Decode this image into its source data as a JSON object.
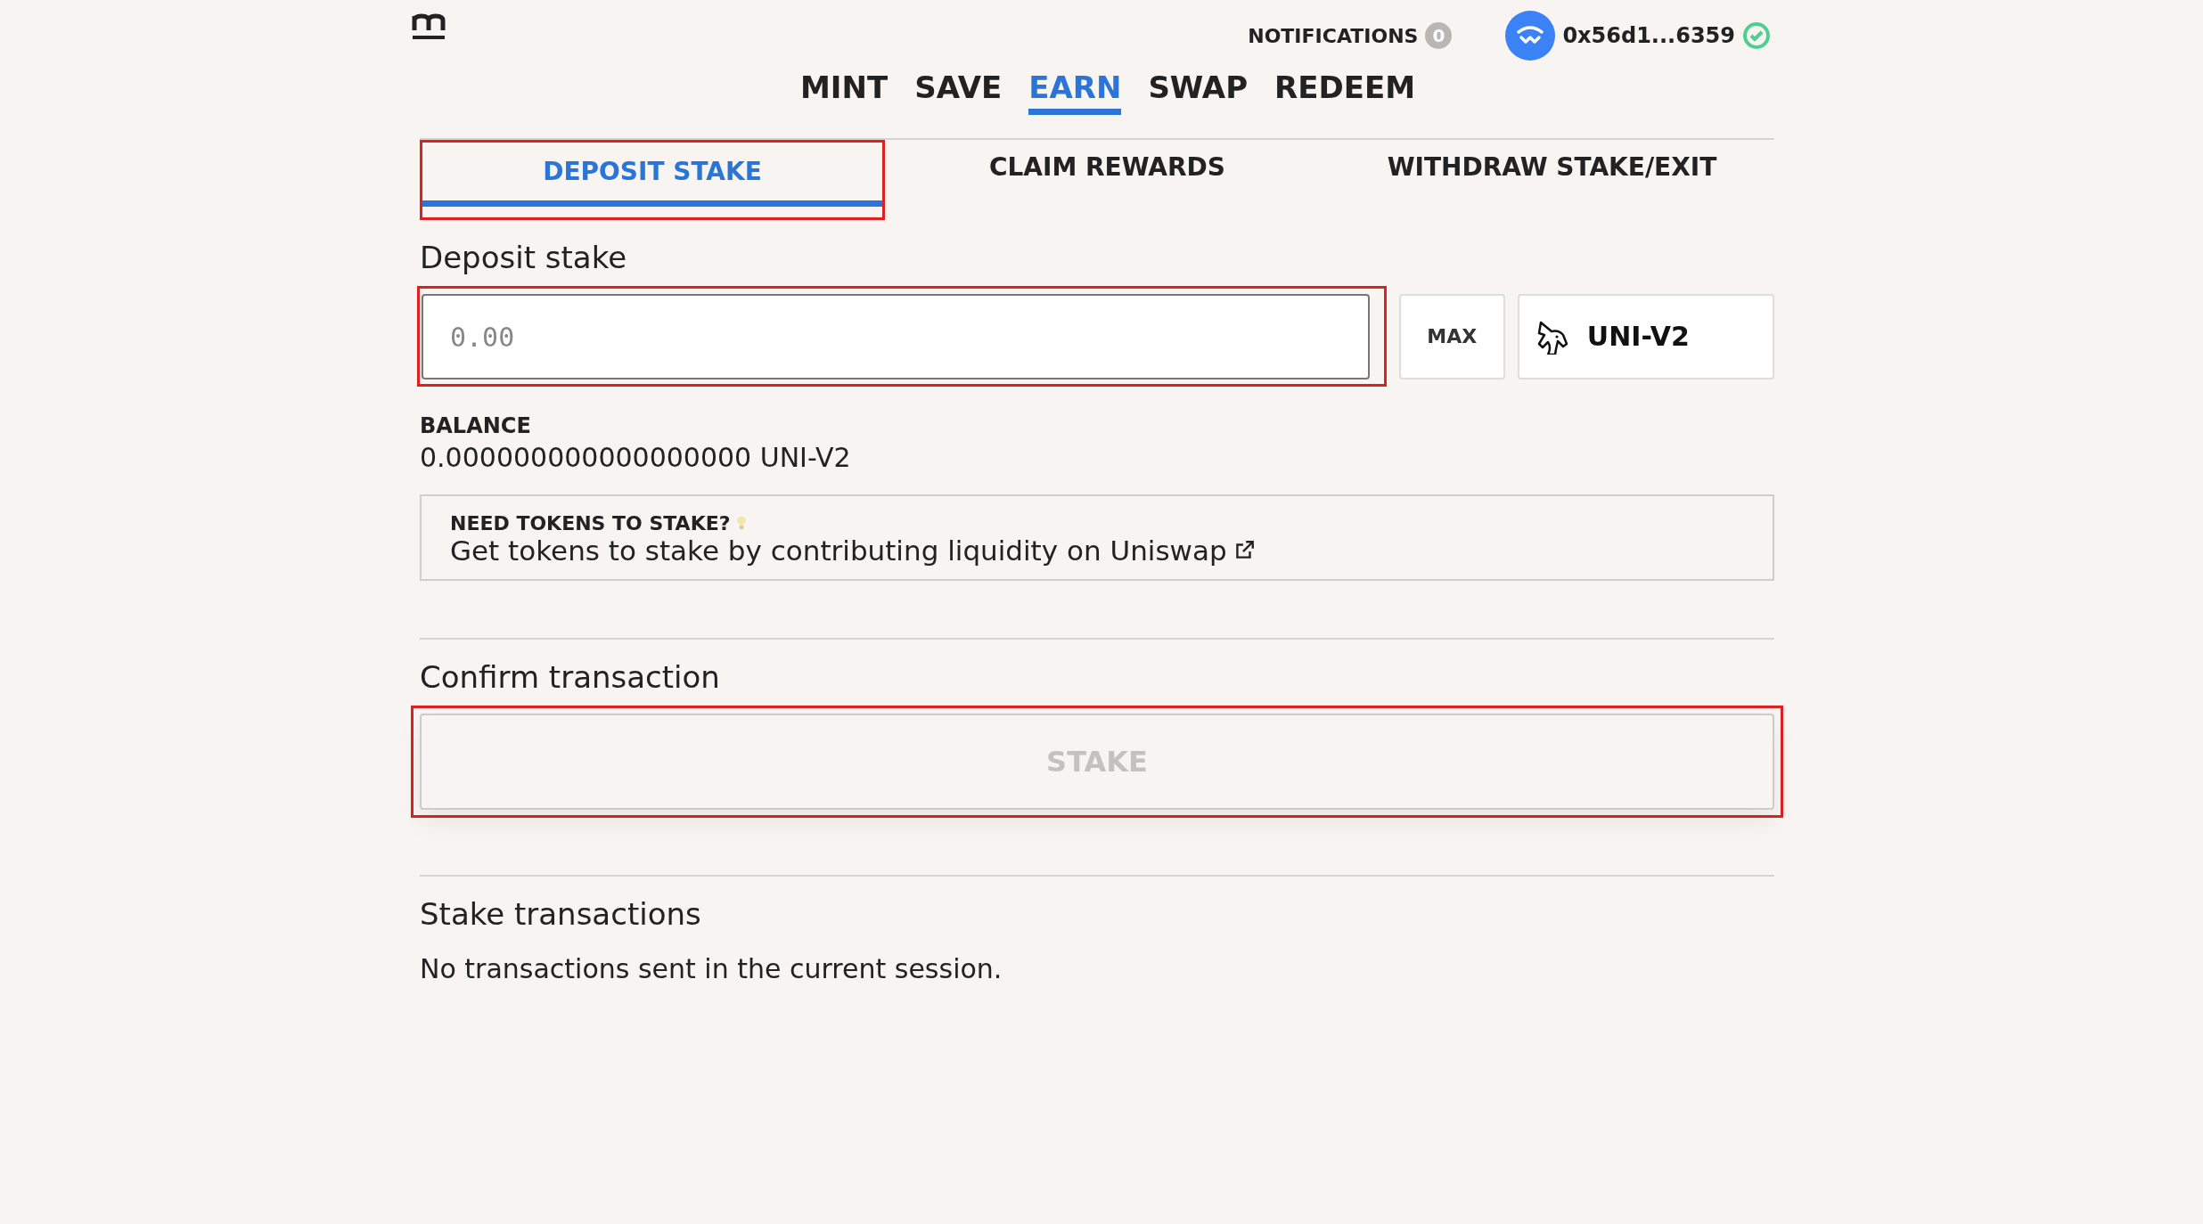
{
  "header": {
    "notifications": {
      "label": "NOTIFICATIONS",
      "count": "0"
    },
    "account": {
      "address": "0x56d1...6359",
      "verified": true
    }
  },
  "nav": [
    {
      "label": "MINT",
      "selected": false
    },
    {
      "label": "SAVE",
      "selected": false
    },
    {
      "label": "EARN",
      "selected": true
    },
    {
      "label": "SWAP",
      "selected": false
    },
    {
      "label": "REDEEM",
      "selected": false
    }
  ],
  "tabs": [
    {
      "label": "DEPOSIT STAKE",
      "selected": true,
      "highlighted": true
    },
    {
      "label": "CLAIM REWARDS",
      "selected": false,
      "highlighted": false
    },
    {
      "label": "WITHDRAW STAKE/EXIT",
      "selected": false,
      "highlighted": false
    }
  ],
  "deposit": {
    "heading": "Deposit stake",
    "amount_field": {
      "placeholder": "0.00",
      "highlighted": true
    },
    "max_button": "MAX",
    "token": "UNI-V2",
    "balance_label": "BALANCE",
    "balance": "0.000000000000000000 UNI-V2"
  },
  "info_box": {
    "title": "NEED TOKENS TO STAKE?",
    "link": "Get tokens to stake by contributing liquidity on Uniswap"
  },
  "confirm": {
    "heading": "Confirm transaction",
    "button": {
      "label": "STAKE",
      "disabled": true,
      "highlighted": true
    }
  },
  "transactions": {
    "heading": "Stake transactions",
    "empty_text": "No transactions sent in the current session."
  }
}
